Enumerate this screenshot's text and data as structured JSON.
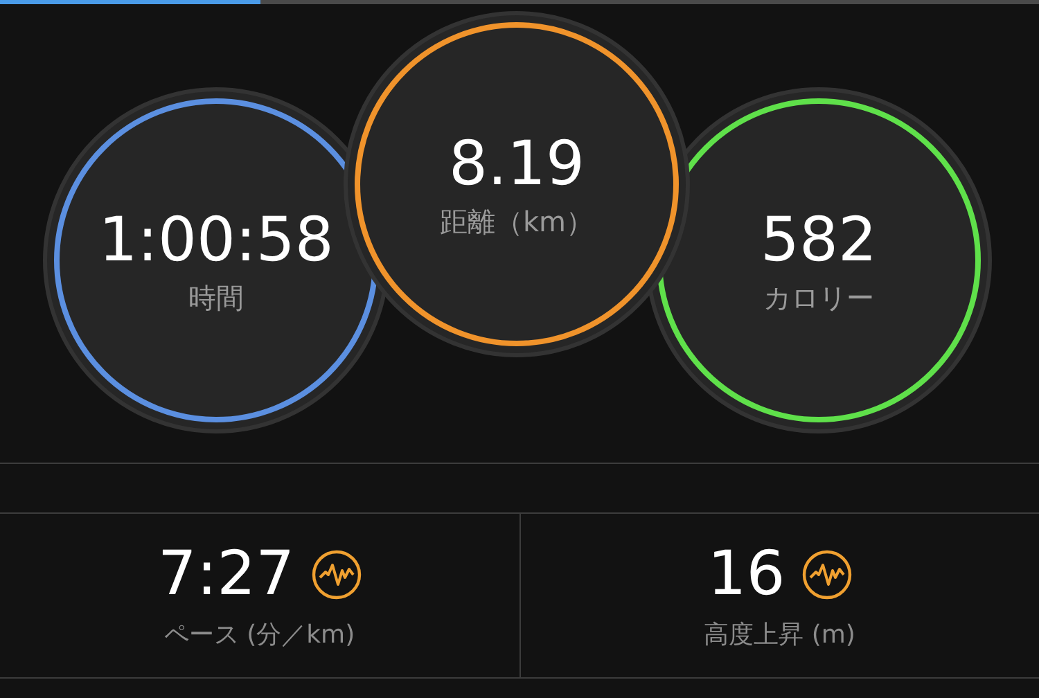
{
  "page_indicator": {
    "level": 0.25
  },
  "rings": [
    {
      "value": "1:00:58",
      "label": "時間",
      "color": "#5b8fe0"
    },
    {
      "value": "8.19",
      "label": "距離（km）",
      "color": "#f0932b"
    },
    {
      "value": "582",
      "label": "カロリー",
      "color": "#5fe04a"
    }
  ],
  "stats": [
    {
      "value": "7:27",
      "label": "ペース (分／km)"
    },
    {
      "value": "16",
      "label": "高度上昇 (m)"
    }
  ]
}
